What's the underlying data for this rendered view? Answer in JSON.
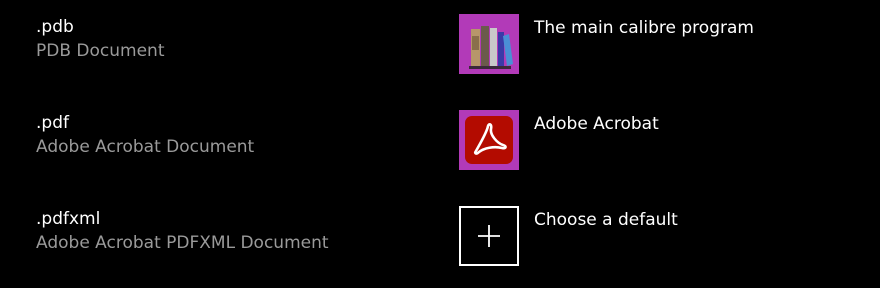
{
  "associations": [
    {
      "extension": ".pdb",
      "description": "PDB Document",
      "app_label": "The main calibre program",
      "app_icon": "calibre-books-icon"
    },
    {
      "extension": ".pdf",
      "description": "Adobe Acrobat Document",
      "app_label": "Adobe Acrobat",
      "app_icon": "adobe-acrobat-icon"
    },
    {
      "extension": ".pdfxml",
      "description": "Adobe Acrobat PDFXML Document",
      "app_label": "Choose a default",
      "app_icon": "plus-icon"
    }
  ],
  "colors": {
    "background": "#000000",
    "primary_text": "#ffffff",
    "secondary_text": "#9a9a9a",
    "icon_tile": "#b23ab8",
    "acrobat_red": "#b30b00"
  }
}
